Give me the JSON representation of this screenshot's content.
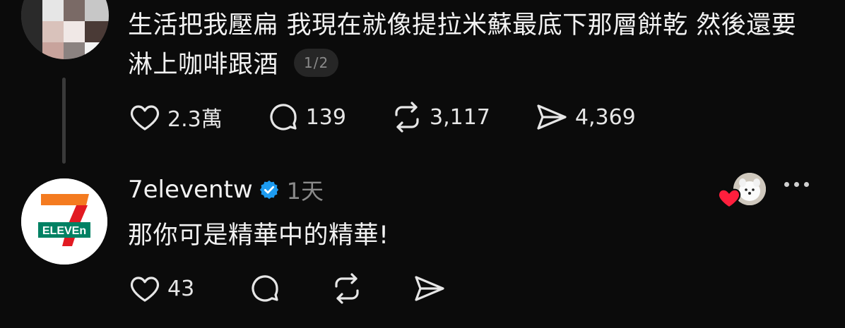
{
  "post": {
    "text_line1": "生活把我壓扁 我現在就像提拉米蘇最底下那層餅乾 然後還要",
    "text_line2": "淋上咖啡跟酒",
    "page_indicator": "1/2",
    "likes": "2.3萬",
    "replies": "139",
    "reposts": "3,117",
    "shares": "4,369"
  },
  "reply": {
    "username": "7eleventw",
    "verified": true,
    "time": "1天",
    "text": "那你可是精華中的精華!",
    "likes": "43",
    "logo_text": "ELEVEn"
  },
  "icons": {
    "like": "heart-icon",
    "reply": "comment-icon",
    "repost": "repost-icon",
    "share": "send-icon",
    "more": "more-icon",
    "verified": "verified-badge-icon"
  },
  "colors": {
    "background": "#0b0b0b",
    "text": "#f2f2f2",
    "muted": "#8a8a8a",
    "verified": "#1d9bf0",
    "heart": "#ff1f3d",
    "logo_orange": "#f47b20",
    "logo_red": "#e21a22",
    "logo_green": "#008163"
  }
}
